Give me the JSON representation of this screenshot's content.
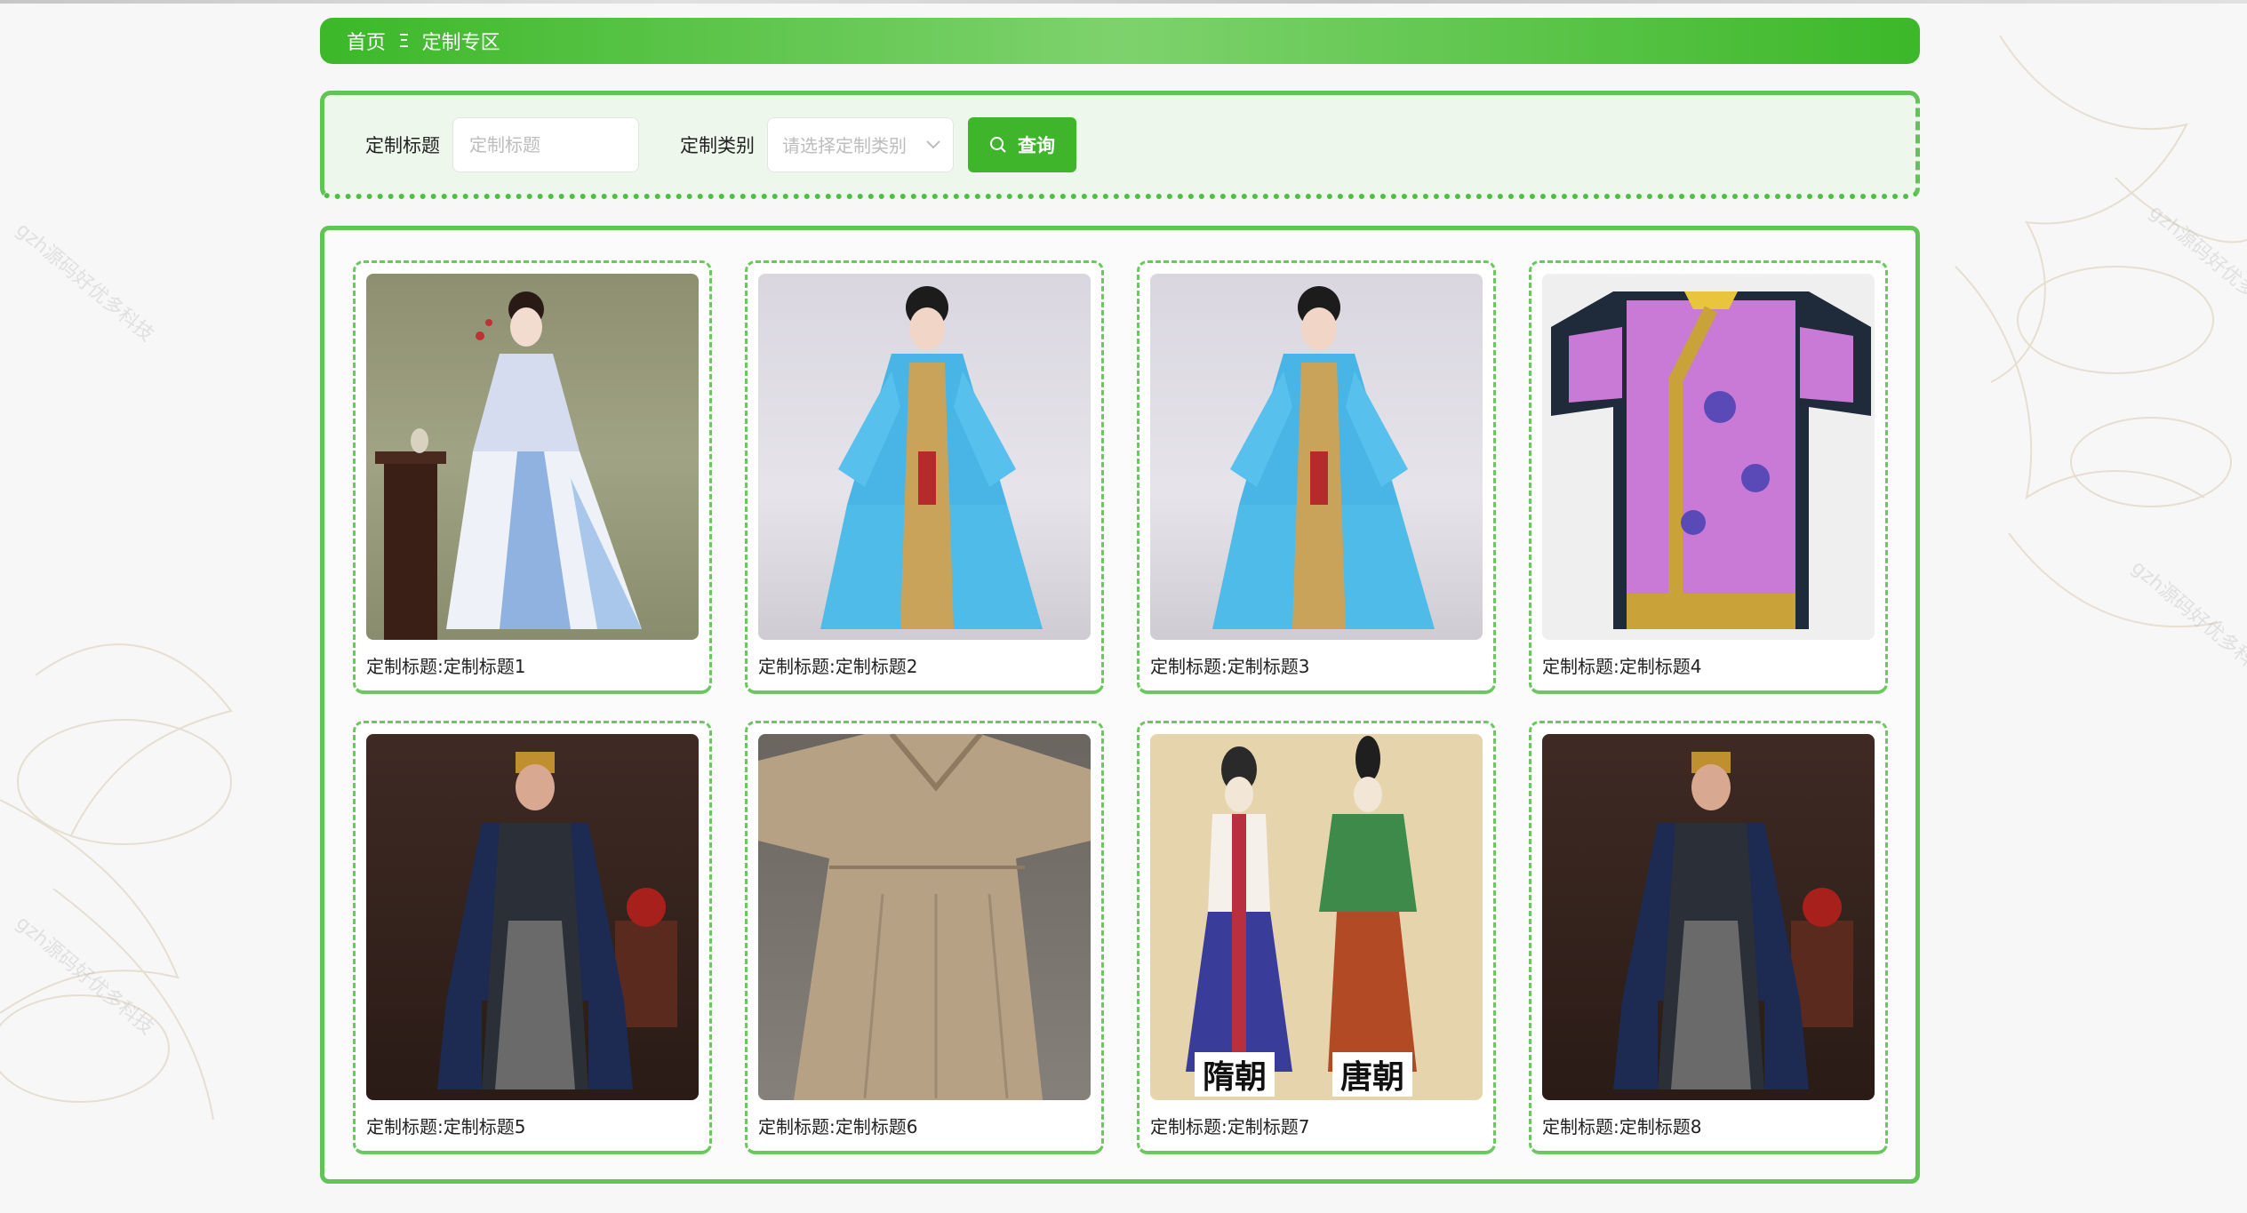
{
  "breadcrumb": {
    "home": "首页",
    "separator": "Ξ",
    "current": "定制专区"
  },
  "search": {
    "title_label": "定制标题",
    "title_placeholder": "定制标题",
    "category_label": "定制类别",
    "category_placeholder": "请选择定制类别",
    "query_button": "查询"
  },
  "products": [
    {
      "title": "定制标题:定制标题1"
    },
    {
      "title": "定制标题:定制标题2"
    },
    {
      "title": "定制标题:定制标题3"
    },
    {
      "title": "定制标题:定制标题4"
    },
    {
      "title": "定制标题:定制标题5"
    },
    {
      "title": "定制标题:定制标题6"
    },
    {
      "title": "定制标题:定制标题7",
      "image_text_left": "隋朝",
      "image_text_right": "唐朝"
    },
    {
      "title": "定制标题:定制标题8"
    }
  ],
  "watermark": "gzh源码好优多科技",
  "colors": {
    "accent": "#3fb52c",
    "border": "#62c356",
    "panel_bg": "#eef7ec"
  }
}
